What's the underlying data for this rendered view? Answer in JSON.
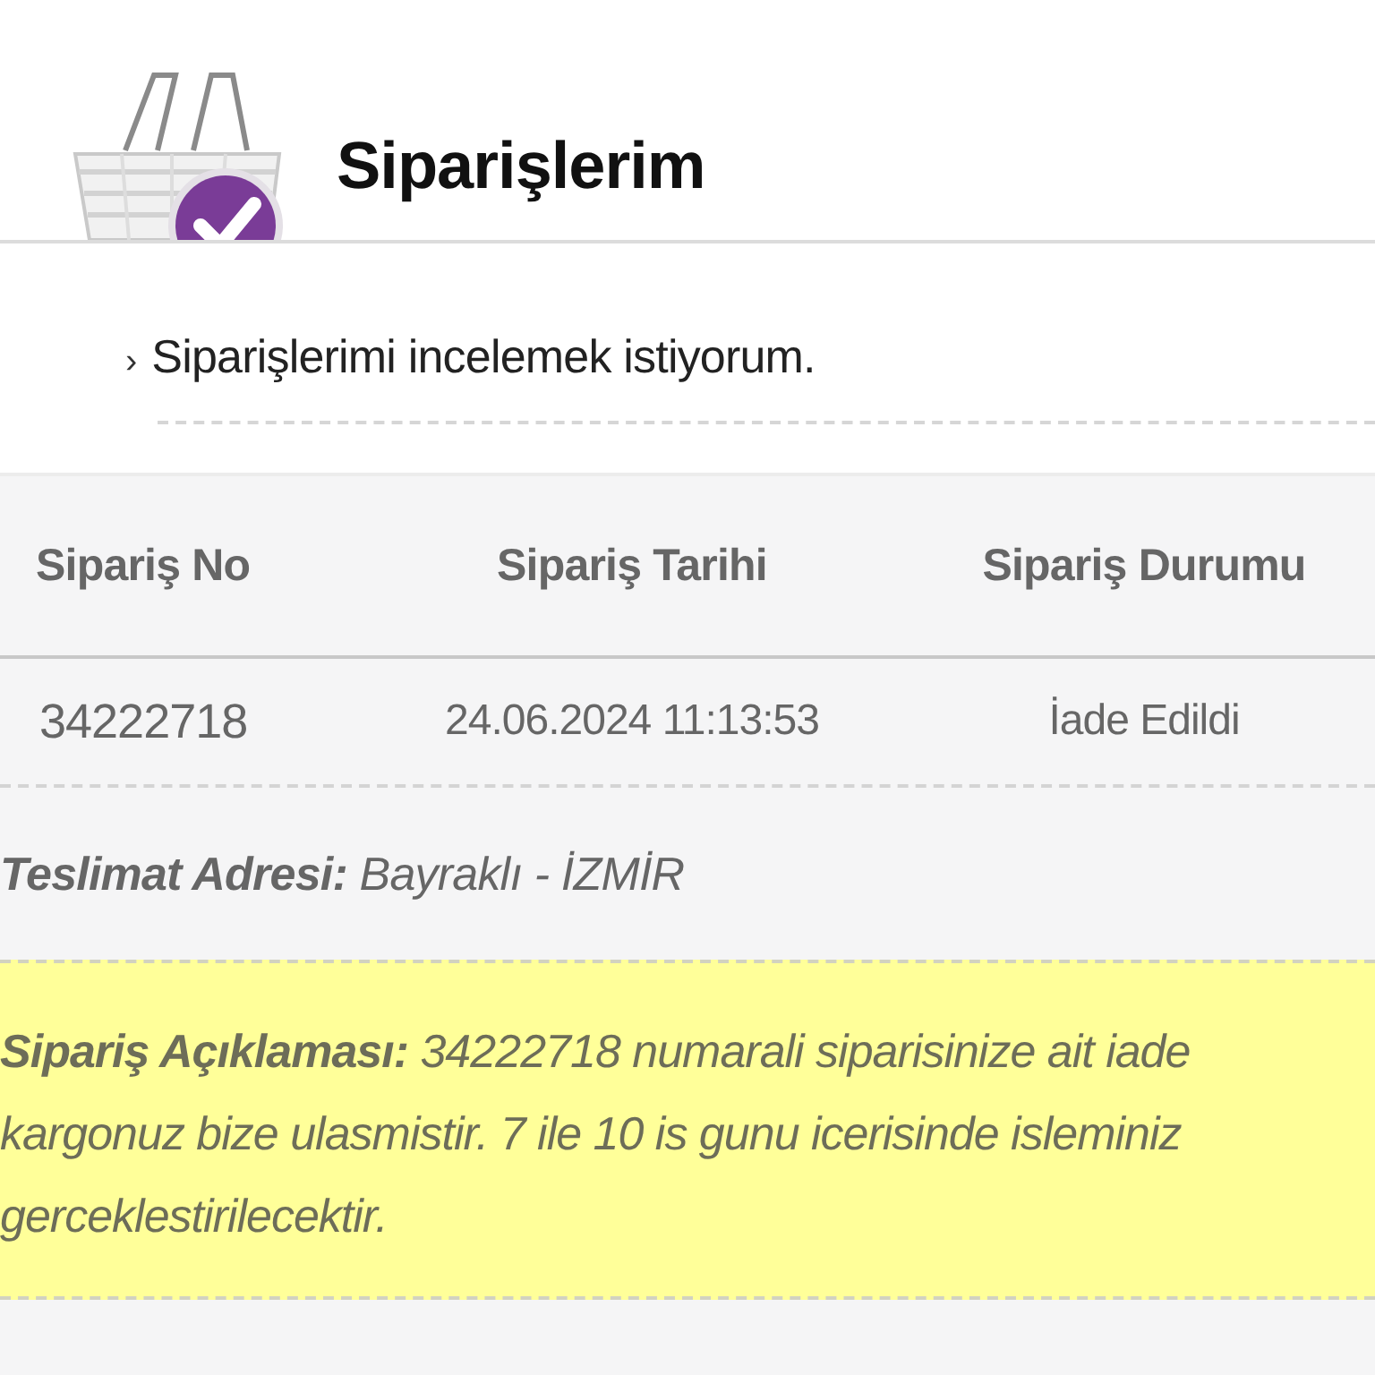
{
  "header": {
    "title": "Siparişlerim"
  },
  "intro_link": {
    "marker": "›",
    "text": "Siparişlerimi incelemek istiyorum."
  },
  "table": {
    "columns": [
      "Sipariş No",
      "Sipariş Tarihi",
      "Sipariş Durumu"
    ],
    "rows": [
      [
        "34222718",
        "24.06.2024 11:13:53",
        "İade Edildi"
      ]
    ]
  },
  "delivery_address": "**Teslimat Adresi:** Bayraklı - İZMİR",
  "order_note": "**Sipariş Açıklaması:** 34222718 numarali siparisinize ait iade kargonuz bize ulasmistir. 7 ile 10 is gunu icerisinde isleminiz gerceklestirilecektir."
}
